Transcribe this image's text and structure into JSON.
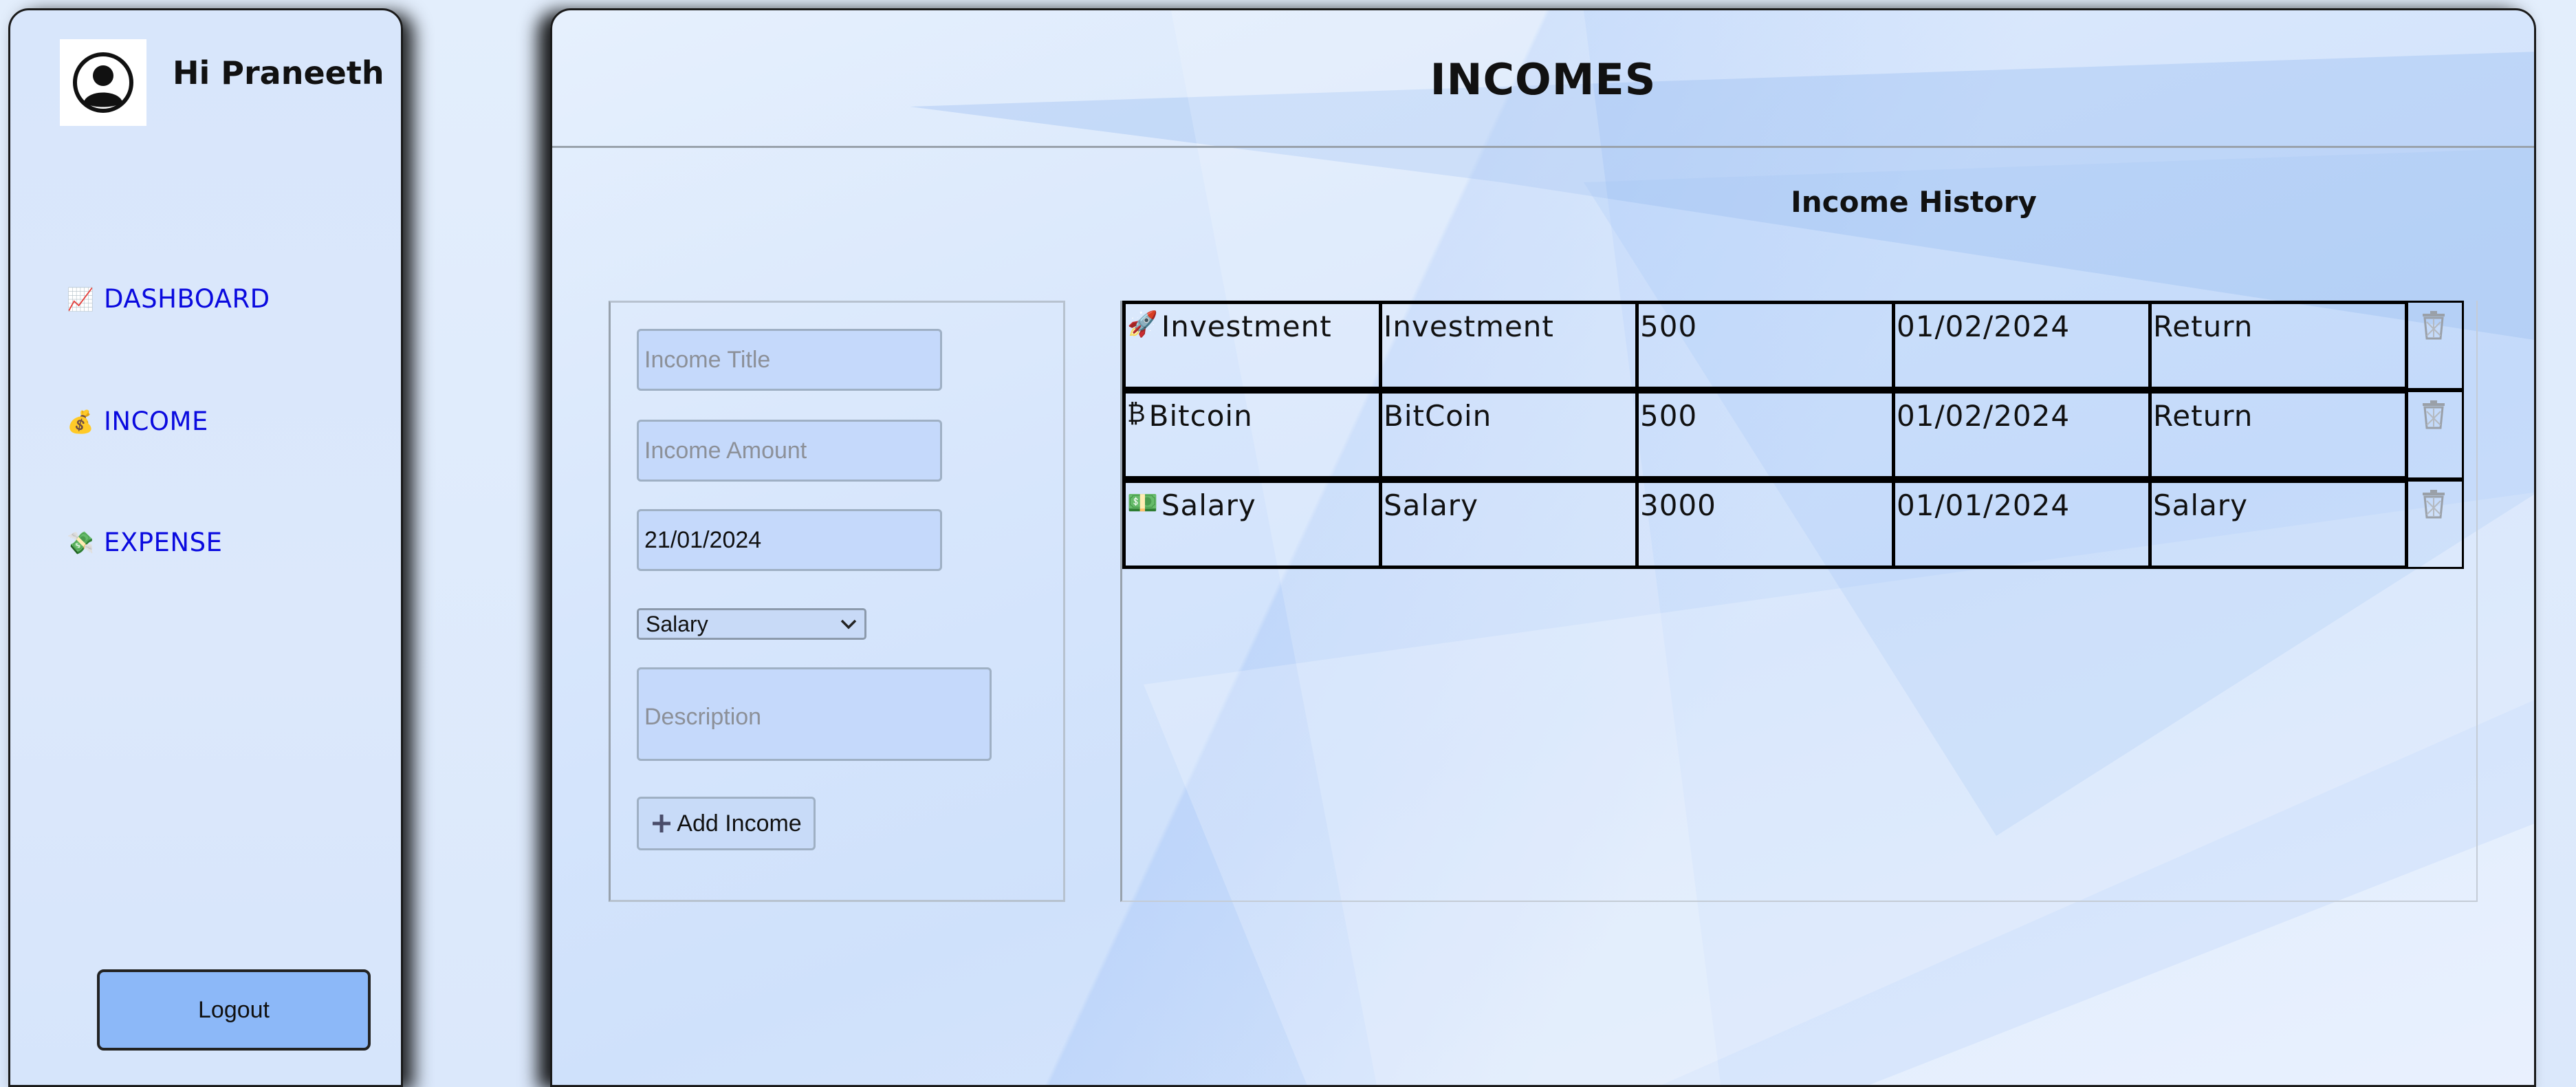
{
  "sidebar": {
    "greeting": "Hi Praneeth",
    "nav": [
      {
        "emoji": "📈",
        "label": "DASHBOARD"
      },
      {
        "emoji": "💰",
        "label": "INCOME"
      },
      {
        "emoji": "💸",
        "label": "EXPENSE"
      }
    ],
    "logout_label": "Logout"
  },
  "header": {
    "title": "INCOMES"
  },
  "history": {
    "title": "Income History",
    "rows": [
      {
        "emoji": "🚀",
        "name": "Investment",
        "category": "Investment",
        "amount": "500",
        "date": "01/02/2024",
        "description": "Return"
      },
      {
        "emoji": "₿",
        "name": "Bitcoin",
        "category": "BitCoin",
        "amount": "500",
        "date": "01/02/2024",
        "description": "Return"
      },
      {
        "emoji": "💵",
        "name": "Salary",
        "category": "Salary",
        "amount": "3000",
        "date": "01/01/2024",
        "description": "Salary"
      }
    ]
  },
  "form": {
    "title_placeholder": "Income Title",
    "amount_placeholder": "Income Amount",
    "date_value": "21/01/2024",
    "category_selected": "Salary",
    "description_placeholder": "Description",
    "add_label": "Add Income"
  },
  "colors": {
    "nav_link": "#0a0adf",
    "logout_bg": "#8cb8f8",
    "field_bg": "#c5d9fb"
  }
}
